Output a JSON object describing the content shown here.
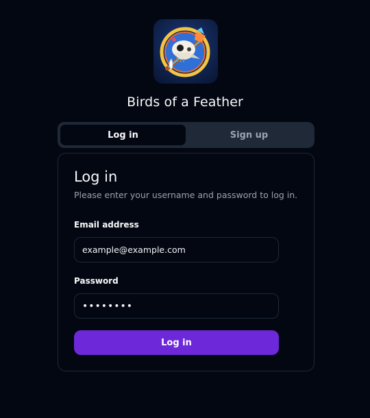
{
  "app": {
    "title": "Birds of a Feather",
    "logo_icon": "bird-skull-feather-icon"
  },
  "tabs": [
    {
      "label": "Log in",
      "active": true
    },
    {
      "label": "Sign up",
      "active": false
    }
  ],
  "card": {
    "title": "Log in",
    "description": "Please enter your username and password to log in.",
    "email": {
      "label": "Email address",
      "value": "example@example.com"
    },
    "password": {
      "label": "Password",
      "value": "••••••••"
    },
    "submit_label": "Log in"
  },
  "colors": {
    "background": "#030712",
    "tab_track": "#1f2937",
    "accent": "#6d28d9",
    "muted_text": "#9ca3af"
  }
}
